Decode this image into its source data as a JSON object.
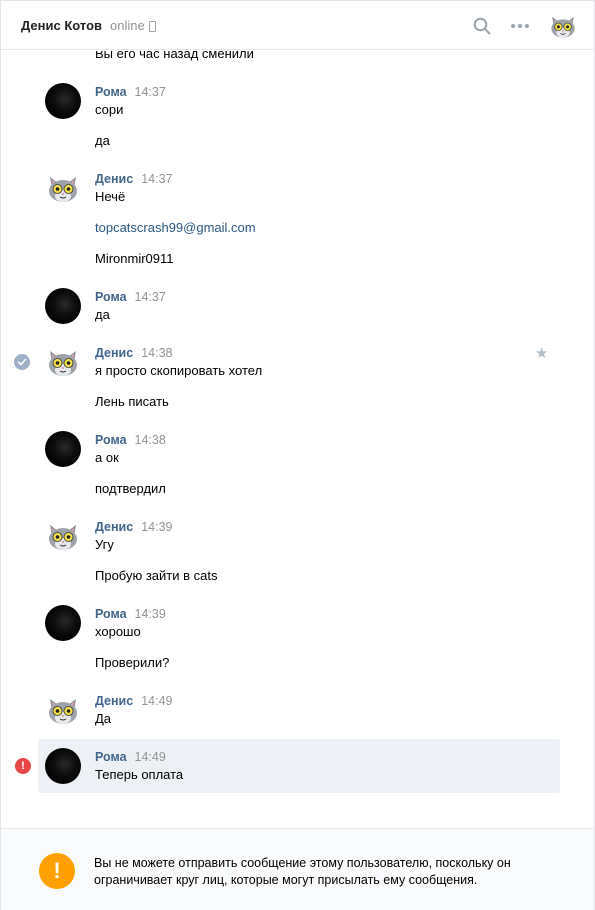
{
  "header": {
    "name": "Денис Котов",
    "status": "online"
  },
  "history": {
    "prev_text": "Вы его час назад сменили",
    "groups": [
      {
        "author": "Рома",
        "time": "14:37",
        "messages": [
          "сори",
          "да"
        ]
      },
      {
        "author": "Денис",
        "time": "14:37",
        "messages": [
          "Нечё",
          "topcatscrash99@gmail.com",
          "Mironmir0911"
        ]
      },
      {
        "author": "Рома",
        "time": "14:37",
        "messages": [
          "да"
        ]
      },
      {
        "author": "Денис",
        "time": "14:38",
        "messages": [
          "я просто скопировать хотел",
          "Лень писать"
        ]
      },
      {
        "author": "Рома",
        "time": "14:38",
        "messages": [
          "а ок",
          "подтвердил"
        ]
      },
      {
        "author": "Денис",
        "time": "14:39",
        "messages": [
          "Угу",
          "Пробую зайти в cats"
        ]
      },
      {
        "author": "Рома",
        "time": "14:39",
        "messages": [
          "хорошо",
          "Проверили?"
        ]
      },
      {
        "author": "Денис",
        "time": "14:49",
        "messages": [
          "Да"
        ]
      },
      {
        "author": "Рома",
        "time": "14:49",
        "messages": [
          "Теперь оплата"
        ]
      }
    ]
  },
  "footer": {
    "warning_icon_symbol": "!",
    "error_icon_symbol": "!",
    "warning_text": "Вы не можете отправить сообщение этому пользователю, поскольку он ограничивает круг лиц, которые могут присылать ему сообщения."
  },
  "icons": {
    "search": "search-icon",
    "more": "more-icon",
    "phone": "phone-icon",
    "check": "check-icon",
    "star": "star-icon",
    "error": "error-icon",
    "warning": "warning-icon"
  },
  "colors": {
    "author": "#42648b",
    "link": "#2a5885",
    "highlight": "#edf0f5",
    "warning": "#ffa000",
    "error": "#e64646"
  }
}
